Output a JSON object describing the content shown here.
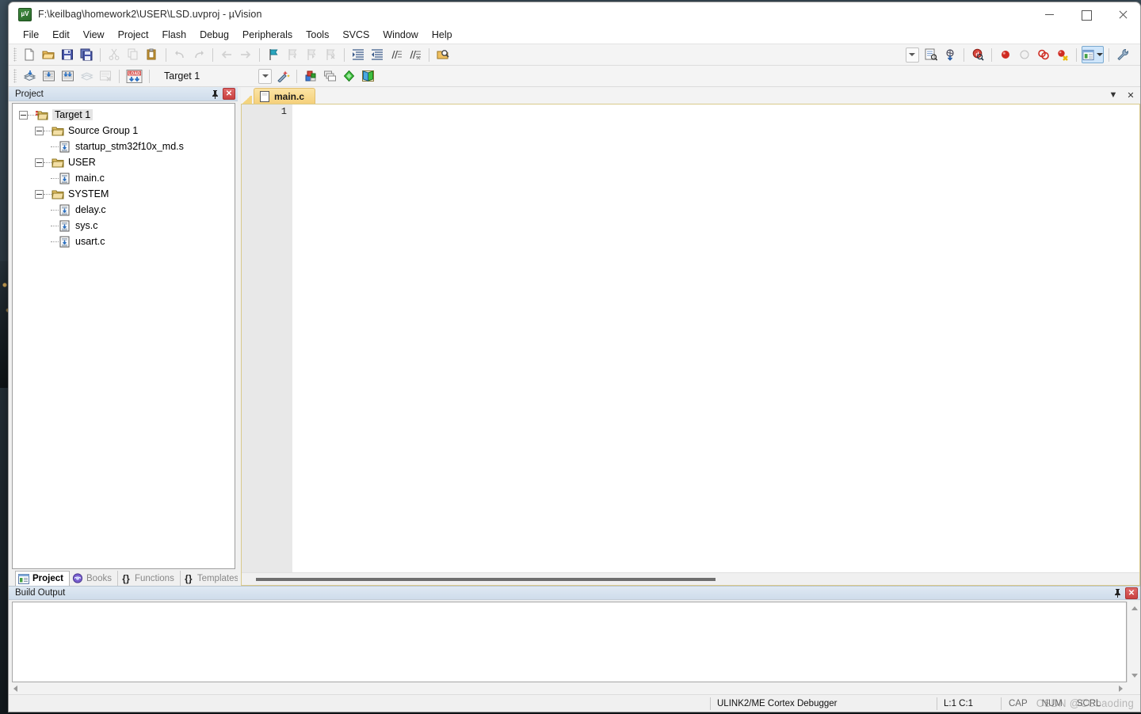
{
  "window": {
    "title": "F:\\keilbag\\homework2\\USER\\LSD.uvproj - µVision",
    "app_icon": "uvision-icon",
    "minimize": "—",
    "maximize": "□",
    "close": "✕"
  },
  "menu": [
    {
      "label": "File"
    },
    {
      "label": "Edit"
    },
    {
      "label": "View"
    },
    {
      "label": "Project"
    },
    {
      "label": "Flash"
    },
    {
      "label": "Debug"
    },
    {
      "label": "Peripherals"
    },
    {
      "label": "Tools"
    },
    {
      "label": "SVCS"
    },
    {
      "label": "Window"
    },
    {
      "label": "Help"
    }
  ],
  "file_toolbar": [
    {
      "name": "new-file-icon",
      "tip": "New"
    },
    {
      "name": "open-file-icon",
      "tip": "Open"
    },
    {
      "name": "save-icon",
      "tip": "Save"
    },
    {
      "name": "save-all-icon",
      "tip": "Save All"
    },
    {
      "name": "cut-icon",
      "tip": "Cut"
    },
    {
      "name": "copy-icon",
      "tip": "Copy"
    },
    {
      "name": "paste-icon",
      "tip": "Paste"
    },
    {
      "name": "undo-icon",
      "tip": "Undo"
    },
    {
      "name": "redo-icon",
      "tip": "Redo"
    },
    {
      "name": "navigate-back-icon",
      "tip": "Back"
    },
    {
      "name": "navigate-forward-icon",
      "tip": "Forward"
    },
    {
      "name": "bookmark-toggle-icon",
      "tip": "Insert/Remove Bookmark"
    },
    {
      "name": "bookmark-prev-icon",
      "tip": "Go to Previous Bookmark"
    },
    {
      "name": "bookmark-next-icon",
      "tip": "Go to Next Bookmark"
    },
    {
      "name": "bookmark-clear-icon",
      "tip": "Clear All Bookmarks"
    },
    {
      "name": "indent-icon",
      "tip": "Indent Selected Text"
    },
    {
      "name": "outdent-icon",
      "tip": "Unindent Selected Text"
    },
    {
      "name": "comment-icon",
      "tip": "Comment Selection"
    },
    {
      "name": "uncomment-icon",
      "tip": "Uncomment Selection"
    },
    {
      "name": "find-in-files-icon",
      "tip": "Find in Files"
    },
    {
      "name": "search-dropdown-icon",
      "tip": "Search Combo"
    },
    {
      "name": "incremental-find-icon",
      "tip": "Incremental Find"
    },
    {
      "name": "debug-start-icon",
      "tip": "Start/Stop Debug Session"
    },
    {
      "name": "insert-breakpoint-icon",
      "tip": "Insert/Remove Breakpoint"
    },
    {
      "name": "disable-breakpoint-icon",
      "tip": "Enable/Disable Breakpoint"
    },
    {
      "name": "disable-all-breakpoints-icon",
      "tip": "Disable All Breakpoints"
    },
    {
      "name": "kill-all-breakpoints-icon",
      "tip": "Kill All Breakpoints"
    },
    {
      "name": "window-manager-icon",
      "tip": "Manage Windows"
    },
    {
      "name": "configure-icon",
      "tip": "Configuration Wizard"
    }
  ],
  "build_toolbar": {
    "buttons": [
      {
        "name": "translate-icon",
        "tip": "Translate Current File"
      },
      {
        "name": "build-icon",
        "tip": "Build"
      },
      {
        "name": "rebuild-icon",
        "tip": "Rebuild"
      },
      {
        "name": "batch-build-icon",
        "tip": "Batch Build"
      },
      {
        "name": "stop-build-icon",
        "tip": "Stop Build"
      },
      {
        "name": "download-icon",
        "tip": "Download",
        "glyph": "LOAD"
      }
    ],
    "target_value": "Target 1",
    "target_options_icon": "target-options-wizard-icon",
    "right_buttons": [
      {
        "name": "manage-project-items-icon",
        "tip": "Manage Project Items"
      },
      {
        "name": "multi-project-icon",
        "tip": "Manage Multi-Project Workspace"
      },
      {
        "name": "pack-installer-icon",
        "tip": "Pack Installer"
      },
      {
        "name": "books-manage-icon",
        "tip": "Open Books Window"
      }
    ]
  },
  "project_panel": {
    "title": "Project",
    "pin_icon": "pin-icon",
    "close_icon": "close-icon",
    "tree": [
      {
        "label": "Target 1",
        "icon": "target-icon",
        "depth": 0,
        "expander": true,
        "selected": true
      },
      {
        "label": "Source Group 1",
        "icon": "folder-icon",
        "depth": 1,
        "expander": true,
        "selected": false
      },
      {
        "label": "startup_stm32f10x_md.s",
        "icon": "file-icon",
        "depth": 2,
        "expander": false,
        "selected": false
      },
      {
        "label": "USER",
        "icon": "folder-icon",
        "depth": 1,
        "expander": true,
        "selected": false
      },
      {
        "label": "main.c",
        "icon": "file-icon",
        "depth": 2,
        "expander": false,
        "selected": false
      },
      {
        "label": "SYSTEM",
        "icon": "folder-icon",
        "depth": 1,
        "expander": true,
        "selected": false
      },
      {
        "label": "delay.c",
        "icon": "file-icon",
        "depth": 2,
        "expander": false,
        "selected": false
      },
      {
        "label": "sys.c",
        "icon": "file-icon",
        "depth": 2,
        "expander": false,
        "selected": false
      },
      {
        "label": "usart.c",
        "icon": "file-icon",
        "depth": 2,
        "expander": false,
        "selected": false
      }
    ],
    "tabs": [
      {
        "label": "Project",
        "icon": "project-tab-icon",
        "active": true
      },
      {
        "label": "Books",
        "icon": "books-tab-icon",
        "active": false
      },
      {
        "label": "Functions",
        "icon": "functions-tab-icon",
        "active": false
      },
      {
        "label": "Templates",
        "icon": "templates-tab-icon",
        "active": false
      }
    ]
  },
  "editor": {
    "tabs": [
      {
        "label": "main.c",
        "icon": "document-icon",
        "active": true
      }
    ],
    "tab_dropdown_icon": "chevron-down-icon",
    "tab_close_icon": "close-icon",
    "line_numbers": [
      "1"
    ],
    "code": ""
  },
  "build_output": {
    "title": "Build Output",
    "pin_icon": "pin-icon",
    "close_icon": "close-icon",
    "text": ""
  },
  "statusbar": {
    "debugger": "ULINK2/ME Cortex Debugger",
    "cursor": "L:1 C:1",
    "keys": [
      "CAP",
      "NUM",
      "SCRL"
    ],
    "watermark": "CSDN @CCbaoding"
  },
  "colors": {
    "active_tab": "#f5d07a",
    "panel_title": "#cfdceb",
    "close_red": "#c94040",
    "gutter": "#e8e8e8"
  }
}
